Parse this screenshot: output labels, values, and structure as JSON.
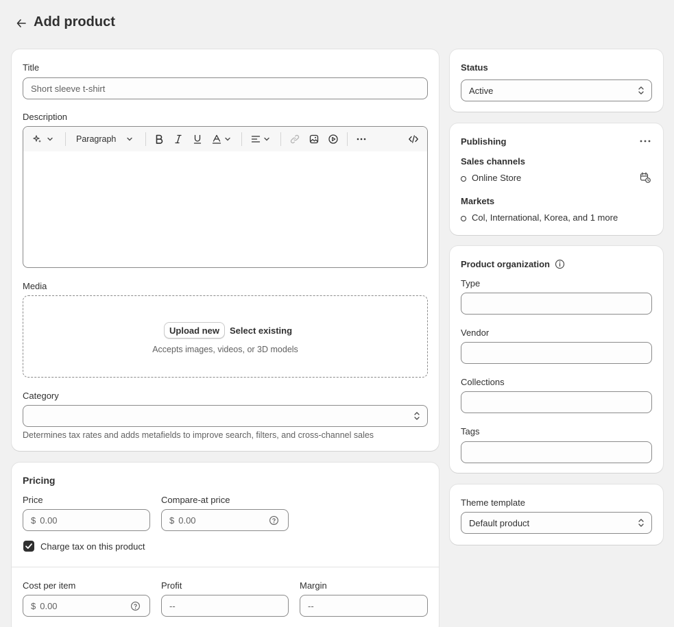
{
  "header": {
    "title": "Add product"
  },
  "main": {
    "title_label": "Title",
    "title_value": "Short sleeve t-shirt",
    "description_label": "Description",
    "editor": {
      "paragraph_label": "Paragraph"
    },
    "media_label": "Media",
    "media": {
      "upload_label": "Upload new",
      "select_label": "Select existing",
      "hint": "Accepts images, videos, or 3D models"
    },
    "category_label": "Category",
    "category_value": "",
    "category_hint": "Determines tax rates and adds metafields to improve search, filters, and cross-channel sales"
  },
  "pricing": {
    "title": "Pricing",
    "price_label": "Price",
    "price_currency": "$",
    "price_placeholder": "0.00",
    "compare_label": "Compare-at price",
    "compare_currency": "$",
    "compare_placeholder": "0.00",
    "charge_tax_label": "Charge tax on this product",
    "charge_tax_checked": true,
    "cost_label": "Cost per item",
    "cost_currency": "$",
    "cost_placeholder": "0.00",
    "profit_label": "Profit",
    "profit_value": "--",
    "margin_label": "Margin",
    "margin_value": "--"
  },
  "status": {
    "title": "Status",
    "value": "Active"
  },
  "publishing": {
    "title": "Publishing",
    "sales_channels_label": "Sales channels",
    "channel": "Online Store",
    "markets_label": "Markets",
    "markets_value": "Col, International, Korea, and 1 more"
  },
  "organization": {
    "title": "Product organization",
    "type_label": "Type",
    "vendor_label": "Vendor",
    "collections_label": "Collections",
    "tags_label": "Tags"
  },
  "theme": {
    "title": "Theme template",
    "value": "Default product"
  }
}
